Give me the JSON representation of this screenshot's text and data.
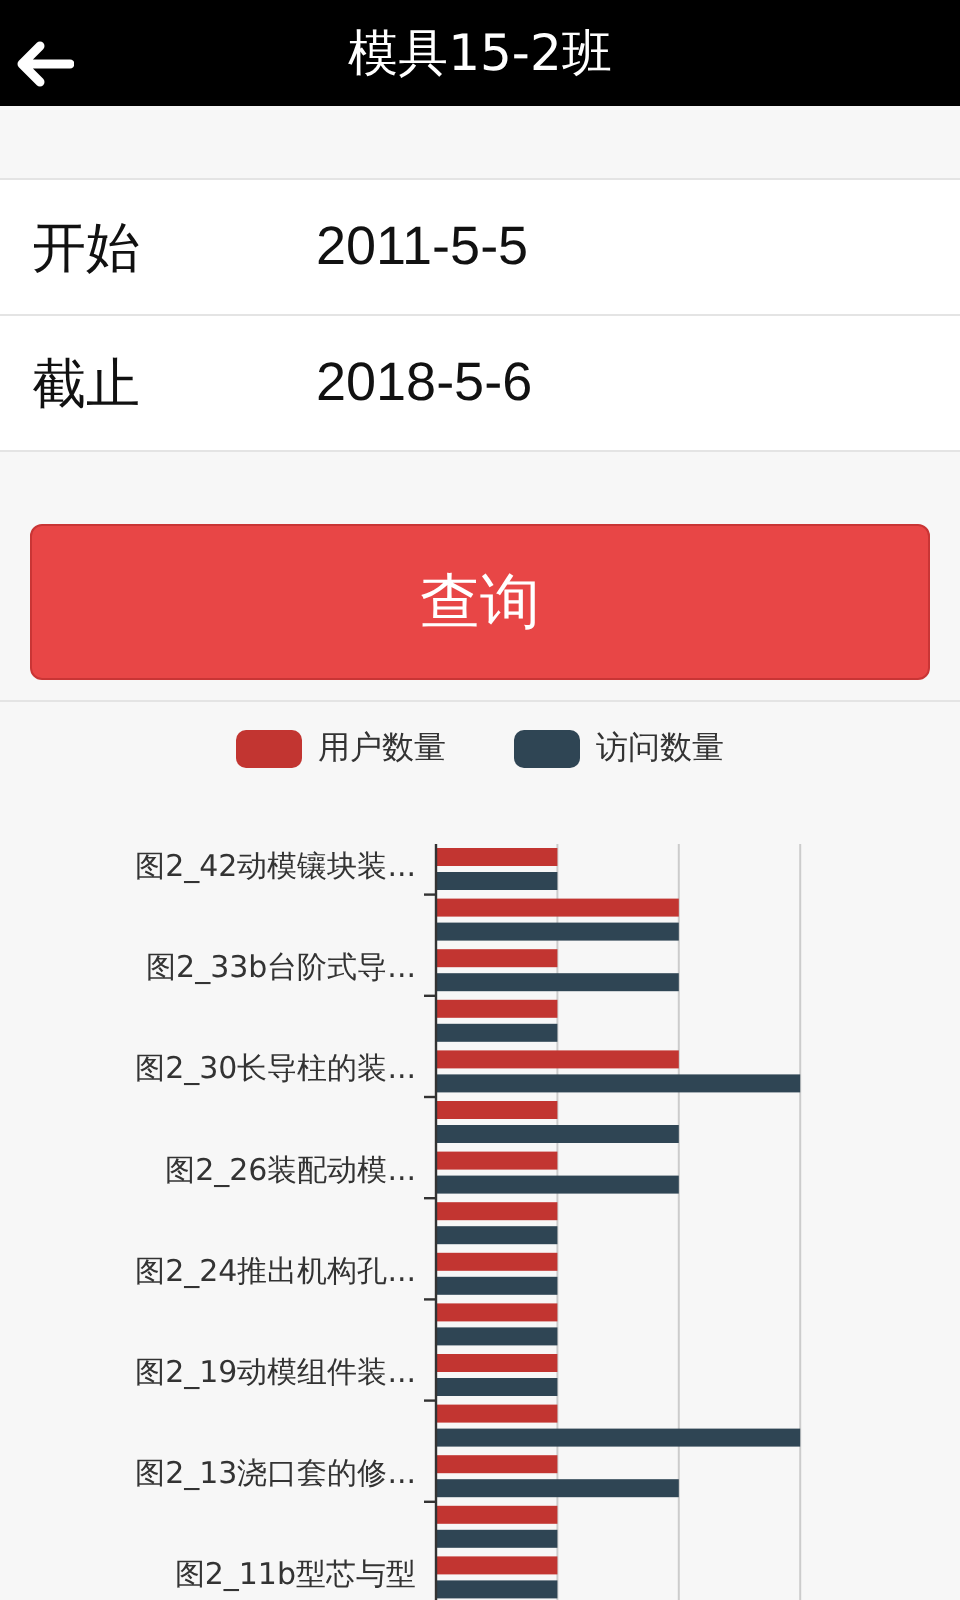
{
  "header": {
    "title": "模具15-2班"
  },
  "form": [
    {
      "label": "开始",
      "value": "2011-5-5"
    },
    {
      "label": "截止",
      "value": "2018-5-6"
    }
  ],
  "query_button": "查询",
  "chart": {
    "legend": [
      {
        "label": "用户数量",
        "color": "#c23531"
      },
      {
        "label": "访问数量",
        "color": "#2f4554"
      }
    ],
    "category_labels": [
      "图2_42动模镶块装...",
      "图2_33b台阶式导...",
      "图2_30长导柱的装...",
      "图2_26装配动模...",
      "图2_24推出机构孔...",
      "图2_19动模组件装...",
      "图2_13浇口套的修...",
      "图2_11b型芯与型"
    ]
  }
}
